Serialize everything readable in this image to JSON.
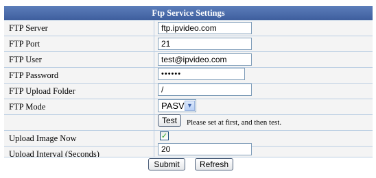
{
  "title": "Ftp Service Settings",
  "fields": {
    "server": {
      "label": "FTP Server",
      "value": "ftp.ipvideo.com"
    },
    "port": {
      "label": "FTP Port",
      "value": "21"
    },
    "user": {
      "label": "FTP User",
      "value": "test@ipvideo.com"
    },
    "password": {
      "label": "FTP Password",
      "value": "••••••"
    },
    "folder": {
      "label": "FTP Upload Folder",
      "value": "/"
    },
    "mode": {
      "label": "FTP Mode",
      "value": "PASV"
    },
    "upload_now": {
      "label": "Upload Image Now",
      "checked": true,
      "mark": "✓"
    },
    "interval": {
      "label": "Upload Interval (Seconds)",
      "value": "20"
    }
  },
  "test": {
    "button": "Test",
    "note": "Please set at first, and then test."
  },
  "buttons": {
    "submit": "Submit",
    "refresh": "Refresh"
  },
  "icons": {
    "select_arrow": "chevron-down-icon",
    "check": "checkmark-icon"
  },
  "colors": {
    "header": "#4a6aab",
    "border": "#99b8d6"
  }
}
